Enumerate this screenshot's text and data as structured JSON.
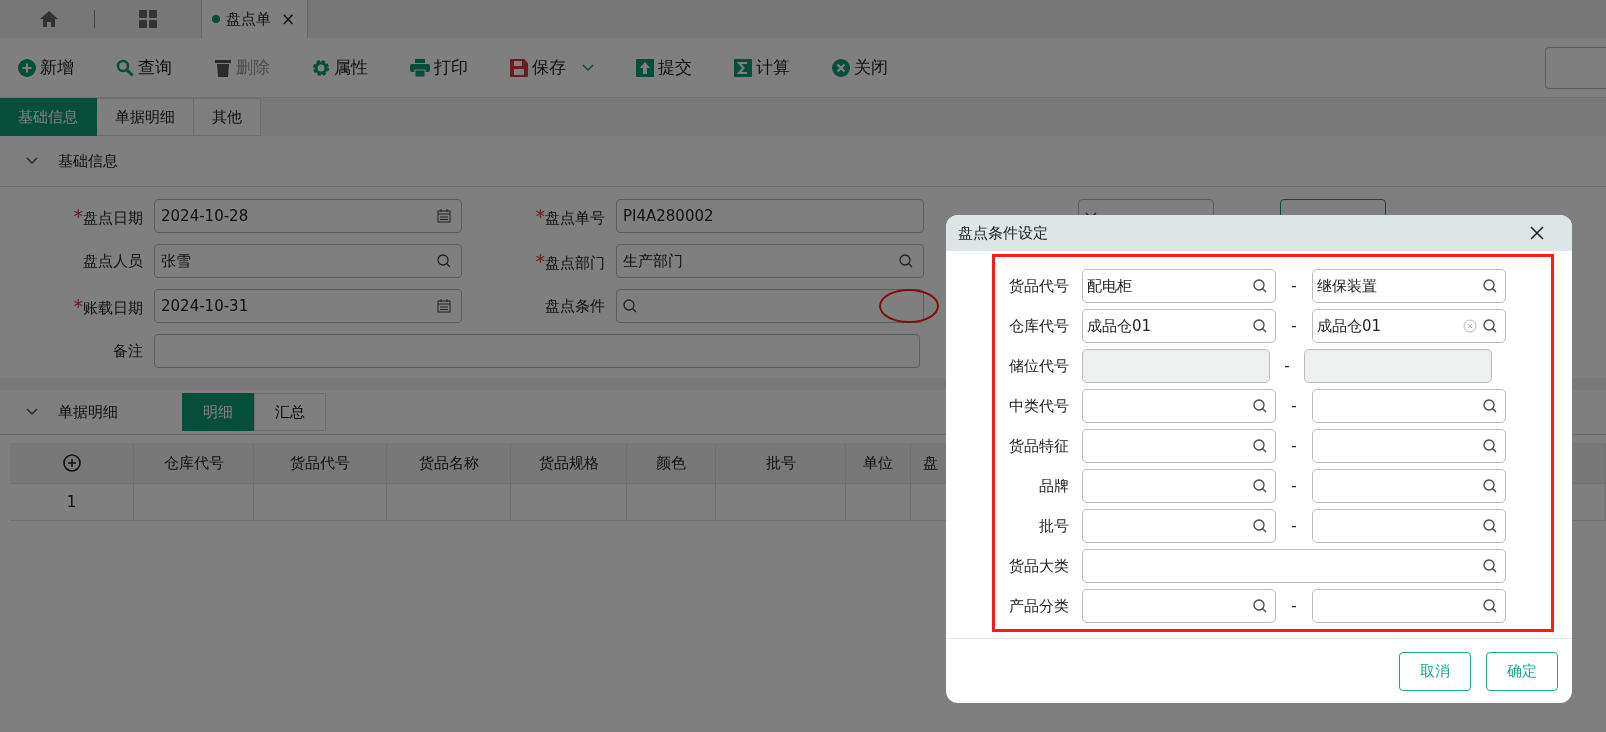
{
  "doc_tab": {
    "label": "盘点单",
    "close": "×"
  },
  "toolbar": [
    {
      "kind": "plus",
      "label": "新增",
      "disabled": false
    },
    {
      "kind": "search",
      "label": "查询",
      "disabled": false
    },
    {
      "kind": "trash",
      "label": "删除",
      "disabled": true
    },
    {
      "kind": "gear",
      "label": "属性",
      "disabled": false
    },
    {
      "kind": "print",
      "label": "打印",
      "disabled": false
    },
    {
      "kind": "save",
      "label": "保存",
      "disabled": false,
      "dropdown": true
    },
    {
      "kind": "upload",
      "label": "提交",
      "disabled": false
    },
    {
      "kind": "sigma",
      "label": "计算",
      "disabled": false
    },
    {
      "kind": "close",
      "label": "关闭",
      "disabled": false
    }
  ],
  "form_tabs": [
    {
      "label": "基础信息",
      "selected": true
    },
    {
      "label": "单据明细",
      "selected": false
    },
    {
      "label": "其他",
      "selected": false
    }
  ],
  "basic_section": {
    "title": "基础信息",
    "expanded": true
  },
  "form_rows": [
    [
      {
        "label": "盘点日期",
        "required": true,
        "kind": "date",
        "value": "2024-10-28"
      },
      {
        "label": "盘点单号",
        "required": true,
        "kind": "text",
        "value": "PI4A280002"
      },
      {
        "kind": "select"
      }
    ],
    [
      {
        "label": "盘点人员",
        "required": false,
        "kind": "search",
        "value": "张雪"
      },
      {
        "label": "盘点部门",
        "required": true,
        "kind": "search",
        "value": "生产部门"
      }
    ],
    [
      {
        "label": "账载日期",
        "required": true,
        "kind": "date",
        "value": "2024-10-31"
      },
      {
        "label": "盘点条件",
        "required": false,
        "kind": "search",
        "highlighted": true
      }
    ]
  ],
  "notes_field": {
    "label": "备注"
  },
  "required_mark": "*",
  "process_button": {
    "shown": true
  },
  "detail_section": {
    "title": "单据明细",
    "expanded": true,
    "view_tabs": [
      {
        "label": "明细",
        "selected": true
      },
      {
        "label": "汇总",
        "selected": false
      }
    ]
  },
  "table": {
    "columns": [
      "仓库代号",
      "货品代号",
      "货品名称",
      "货品规格",
      "颜色",
      "批号",
      "单位",
      "盘"
    ],
    "rows": [
      {
        "number": "1"
      }
    ]
  },
  "dialog": {
    "title": "盘点条件设定",
    "highlighted": true,
    "rows": [
      {
        "label": "货品代号",
        "kind": "range",
        "disabled": false,
        "from": {
          "value": "配电柜"
        },
        "to": {
          "value": "继保装置"
        }
      },
      {
        "label": "仓库代号",
        "kind": "range",
        "disabled": false,
        "from": {
          "value": "成品仓01"
        },
        "to": {
          "value": "成品仓01",
          "clearable": true
        }
      },
      {
        "label": "储位代号",
        "kind": "range",
        "disabled": true,
        "from": {},
        "to": {}
      },
      {
        "label": "中类代号",
        "kind": "range",
        "disabled": false,
        "from": {},
        "to": {}
      },
      {
        "label": "货品特征",
        "kind": "range",
        "disabled": false,
        "from": {},
        "to": {}
      },
      {
        "label": "品牌",
        "kind": "range",
        "disabled": false,
        "from": {},
        "to": {}
      },
      {
        "label": "批号",
        "kind": "range",
        "disabled": false,
        "from": {},
        "to": {}
      },
      {
        "label": "货品大类",
        "kind": "single",
        "disabled": false,
        "from": {}
      },
      {
        "label": "产品分类",
        "kind": "range",
        "disabled": false,
        "from": {},
        "to": {}
      }
    ],
    "separator": "-",
    "buttons": [
      {
        "label": "取消"
      },
      {
        "label": "确定"
      }
    ]
  }
}
